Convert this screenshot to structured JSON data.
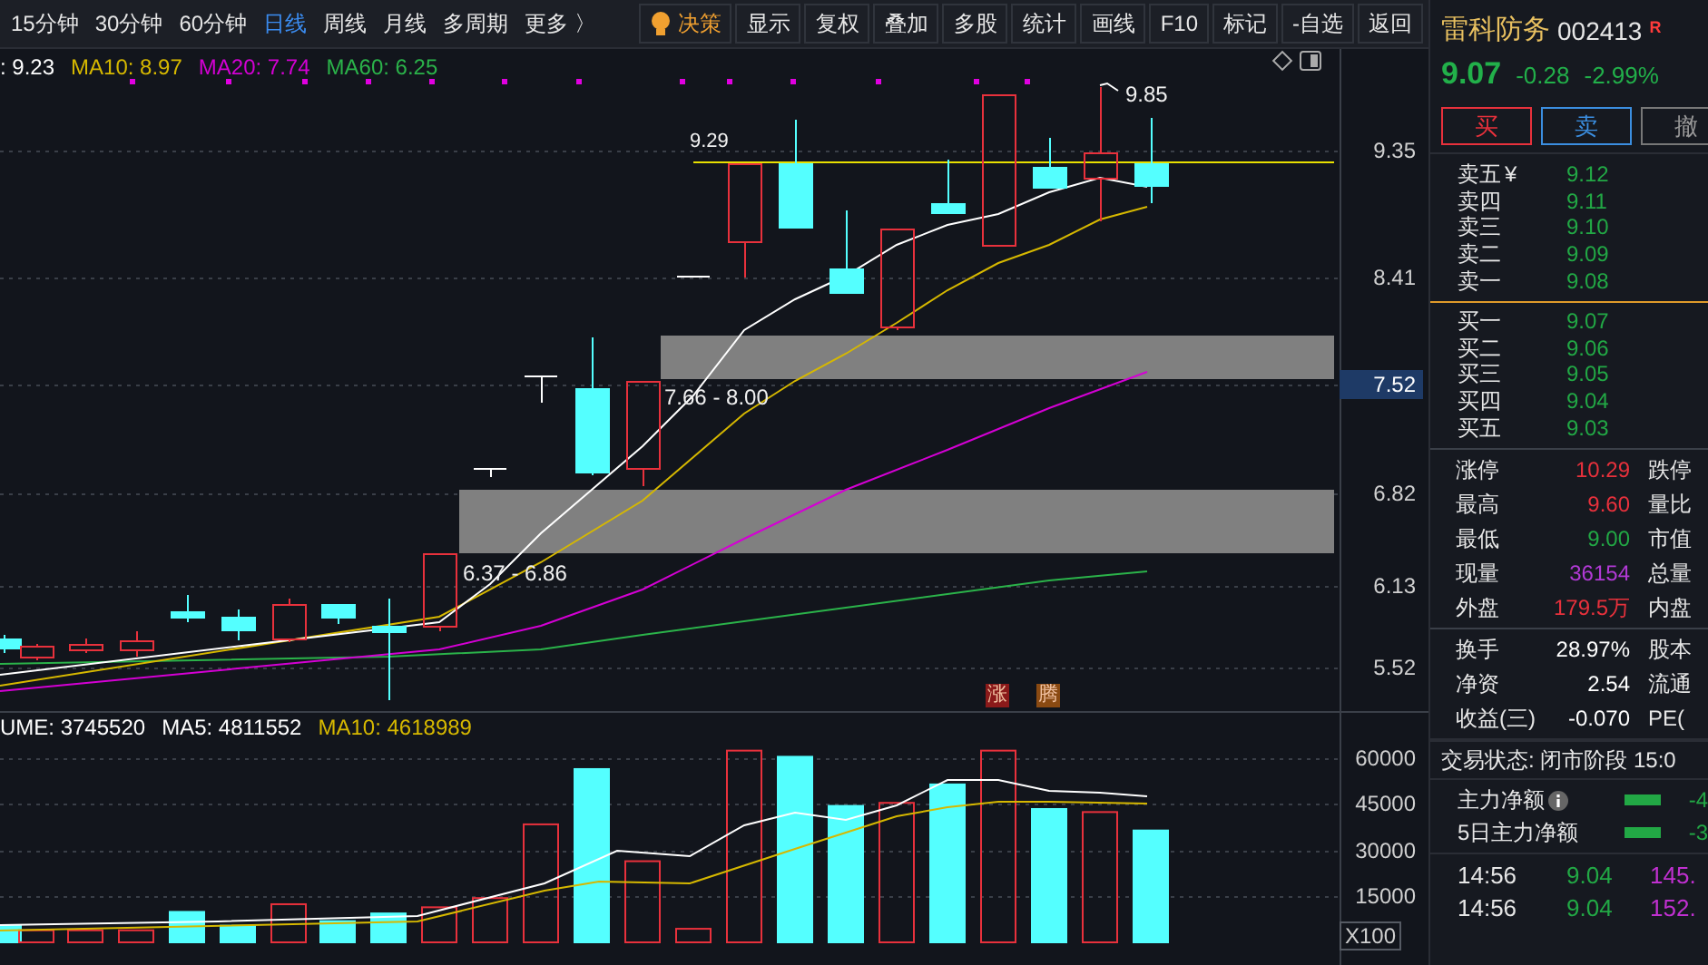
{
  "toolbar": {
    "periods": [
      {
        "label": "15分钟",
        "selected": false
      },
      {
        "label": "30分钟",
        "selected": false
      },
      {
        "label": "60分钟",
        "selected": false
      },
      {
        "label": "日线",
        "selected": true
      },
      {
        "label": "周线",
        "selected": false
      },
      {
        "label": "月线",
        "selected": false
      },
      {
        "label": "多周期",
        "selected": false
      },
      {
        "label": "更多 〉",
        "selected": false
      }
    ],
    "actions": [
      {
        "label": "决策",
        "kind": "highlight"
      },
      {
        "label": "显示",
        "kind": "plain"
      },
      {
        "label": "复权",
        "kind": "plain"
      },
      {
        "label": "叠加",
        "kind": "plain"
      },
      {
        "label": "多股",
        "kind": "plain"
      },
      {
        "label": "统计",
        "kind": "plain"
      },
      {
        "label": "画线",
        "kind": "plain"
      },
      {
        "label": "F10",
        "kind": "plain"
      },
      {
        "label": "标记",
        "kind": "plain"
      },
      {
        "label": "-自选",
        "kind": "plain"
      },
      {
        "label": "返回",
        "kind": "plain"
      }
    ]
  },
  "price_chart": {
    "legend": [
      {
        "text": ": 9.23",
        "color": "#ffffff"
      },
      {
        "text": "MA10: 8.97",
        "color": "#d6b800"
      },
      {
        "text": "MA20: 7.74",
        "color": "#d400d4"
      },
      {
        "text": "MA60: 6.25",
        "color": "#2bb34a"
      }
    ],
    "resistance_line_label": "9.29",
    "zone_labels": [
      "7.66 - 8.00",
      "6.37 - 6.86"
    ],
    "high_label": "9.85",
    "y_axis": [
      {
        "label": "9.35",
        "selected": false
      },
      {
        "label": "8.41",
        "selected": false
      },
      {
        "label": "7.52",
        "selected": true
      },
      {
        "label": "6.82",
        "selected": false
      },
      {
        "label": "6.13",
        "selected": false
      },
      {
        "label": "5.52",
        "selected": false
      }
    ],
    "tags": [
      {
        "text": "涨",
        "color": "#8b1a1a"
      },
      {
        "text": "腾",
        "color": "#8a4a12"
      }
    ]
  },
  "volume_chart": {
    "legend": [
      {
        "text": "UME: 3745520",
        "color": "#ffffff"
      },
      {
        "text": "MA5: 4811552",
        "color": "#ffffff"
      },
      {
        "text": "MA10: 4618989",
        "color": "#d6b800"
      }
    ],
    "y_axis": [
      "60000",
      "45000",
      "30000",
      "15000"
    ],
    "unit": "X100"
  },
  "quote": {
    "name": "雷科防务",
    "code": "002413",
    "badge": "R",
    "price": "9.07",
    "change": "-0.28",
    "change_pct": "-2.99%",
    "buttons": [
      {
        "label": "买",
        "kind": "buy"
      },
      {
        "label": "卖",
        "kind": "sell"
      },
      {
        "label": "撤",
        "kind": "cancel"
      }
    ],
    "asks": [
      {
        "label": "卖五",
        "marker": "¥",
        "price": "9.12"
      },
      {
        "label": "卖四",
        "price": "9.11"
      },
      {
        "label": "卖三",
        "price": "9.10"
      },
      {
        "label": "卖二",
        "price": "9.09"
      },
      {
        "label": "卖一",
        "price": "9.08"
      }
    ],
    "bids": [
      {
        "label": "买一",
        "price": "9.07"
      },
      {
        "label": "买二",
        "price": "9.06"
      },
      {
        "label": "买三",
        "price": "9.05"
      },
      {
        "label": "买四",
        "price": "9.04"
      },
      {
        "label": "买五",
        "price": "9.03"
      }
    ],
    "stats": [
      {
        "label": "涨停",
        "value": "10.29",
        "color": "#e8313c",
        "label_2": "跌停"
      },
      {
        "label": "最高",
        "value": "9.60",
        "color": "#e8313c",
        "label_2": "量比"
      },
      {
        "label": "最低",
        "value": "9.00",
        "color": "#22a845",
        "label_2": "市值"
      },
      {
        "label": "现量",
        "value": "36154",
        "color": "#b23ad6",
        "label_2": "总量"
      },
      {
        "label": "外盘",
        "value": "179.5万",
        "color": "#e8313c",
        "label_2": "内盘"
      }
    ],
    "stats_2": [
      {
        "label": "换手",
        "value": "28.97%",
        "color": "#ffffff",
        "label_2": "股本"
      },
      {
        "label": "净资",
        "value": "2.54",
        "color": "#ffffff",
        "label_2": "流通"
      },
      {
        "label": "收益(三)",
        "value": "-0.070",
        "color": "#ffffff",
        "label_2": "PE("
      }
    ],
    "trade_status": "交易状态: 闭市阶段 15:0",
    "capital_flow": [
      {
        "label": "主力净额",
        "info": true,
        "value": "-4"
      },
      {
        "label": "5日主力净额",
        "info": false,
        "value": "-3"
      }
    ],
    "ticks": [
      {
        "time": "14:56",
        "price": "9.04",
        "volume": "145."
      },
      {
        "time": "14:56",
        "price": "9.04",
        "volume": "152."
      }
    ]
  }
}
